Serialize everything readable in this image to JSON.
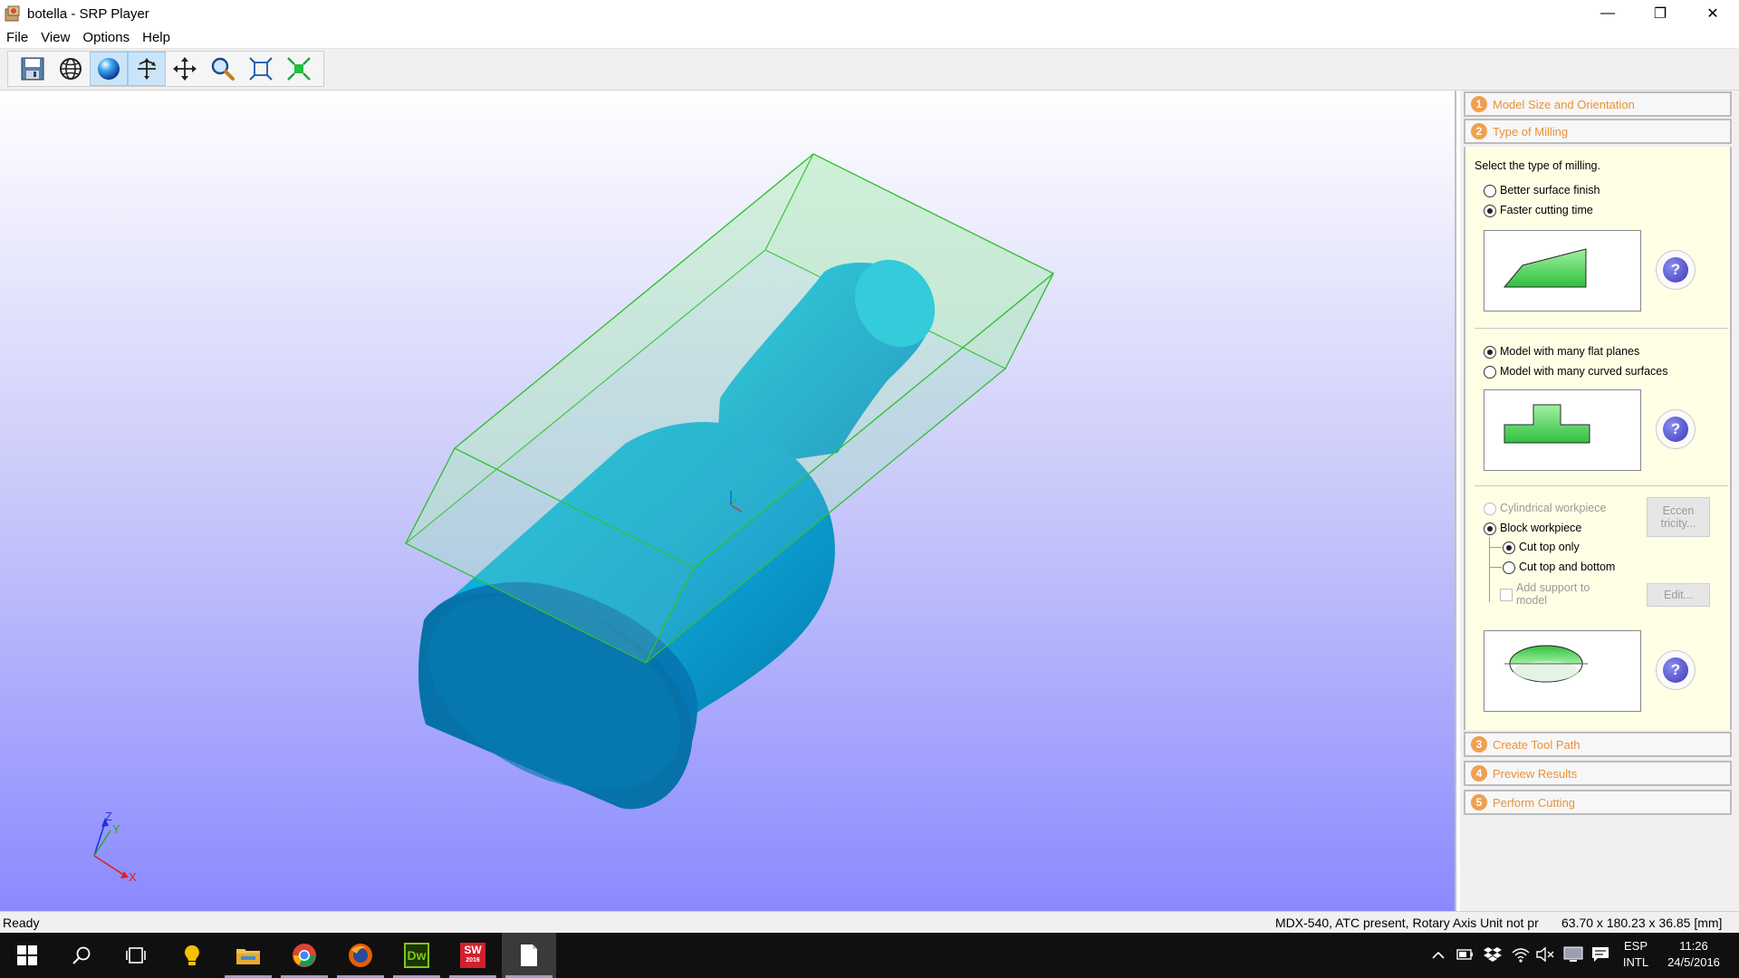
{
  "window": {
    "title": "botella - SRP Player",
    "controls": {
      "minimize": "—",
      "maximize": "❐",
      "close": "✕"
    }
  },
  "menu": [
    "File",
    "View",
    "Options",
    "Help"
  ],
  "toolbar": {
    "buttons": [
      {
        "icon": "save-icon",
        "active": false
      },
      {
        "icon": "wireframe-globe-icon",
        "active": false
      },
      {
        "icon": "shaded-sphere-icon",
        "active": true
      },
      {
        "icon": "rotate-icon",
        "active": true
      },
      {
        "icon": "pan-icon",
        "active": false
      },
      {
        "icon": "zoom-icon",
        "active": false
      },
      {
        "icon": "fit-window-icon",
        "active": false
      },
      {
        "icon": "fit-model-icon",
        "active": false
      }
    ]
  },
  "viewport": {
    "axes": {
      "z": "Z",
      "y": "Y",
      "x": "X"
    },
    "colors": {
      "model": "#10b0d8",
      "bounding_box": "#30c030"
    }
  },
  "panel": {
    "steps": [
      {
        "num": "1",
        "label": "Model Size and Orientation"
      },
      {
        "num": "2",
        "label": "Type of Milling"
      },
      {
        "num": "3",
        "label": "Create Tool Path"
      },
      {
        "num": "4",
        "label": "Preview Results"
      },
      {
        "num": "5",
        "label": "Perform Cutting"
      }
    ],
    "milling": {
      "instruction": "Select the type of milling.",
      "finish_options": [
        {
          "label": "Better surface finish",
          "checked": false
        },
        {
          "label": "Faster cutting time",
          "checked": true
        }
      ],
      "model_options": [
        {
          "label": "Model with many flat planes",
          "checked": true
        },
        {
          "label": "Model with many curved surfaces",
          "checked": false
        }
      ],
      "workpiece_options": [
        {
          "label": "Cylindrical workpiece",
          "checked": false,
          "enabled": false
        },
        {
          "label": "Block workpiece",
          "checked": true,
          "enabled": true
        }
      ],
      "cut_options": [
        {
          "label": "Cut top only",
          "checked": true
        },
        {
          "label": "Cut top and bottom",
          "checked": false
        }
      ],
      "eccentricity_button": [
        "Eccen",
        "tricity..."
      ],
      "support_checkbox": {
        "label_line1": "Add support to",
        "label_line2": "model",
        "checked": false
      },
      "edit_button": "Edit...",
      "help_symbol": "?"
    }
  },
  "status": {
    "left": "Ready",
    "machine": "MDX-540, ATC present, Rotary Axis Unit not pr",
    "dimensions": "63.70 x 180.23 x  36.85 [mm]"
  },
  "taskbar": {
    "apps": [
      "start",
      "search",
      "task-view",
      "tips",
      "file-explorer",
      "chrome",
      "firefox",
      "dreamweaver",
      "solidworks",
      "document"
    ],
    "dreamweaver_label": "Dw",
    "solidworks_label": "SW",
    "solidworks_year": "2016",
    "language_line1": "ESP",
    "language_line2": "INTL",
    "time": "11:26",
    "date": "24/5/2016"
  }
}
